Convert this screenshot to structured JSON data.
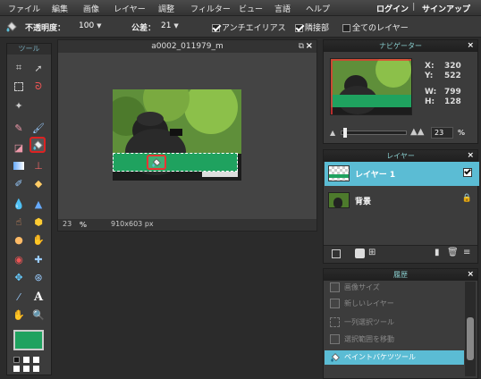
{
  "menubar": {
    "items": [
      "ファイル",
      "編集",
      "画像",
      "レイヤー",
      "調整",
      "フィルター",
      "ビュー",
      "言語",
      "ヘルプ"
    ],
    "login": "ログイン",
    "separator": "|",
    "signup": "サインアップ"
  },
  "options": {
    "opacity_label": "不透明度：",
    "opacity_value": "100",
    "tolerance_label": "公差：",
    "tolerance_value": "21",
    "antialias_label": "アンチエイリアス",
    "contiguous_label": "隣接部",
    "all_layers_label": "全てのレイヤー"
  },
  "toolbox": {
    "title": "ツール"
  },
  "document": {
    "title": "a0002_011979_m",
    "zoom": "23",
    "zoom_unit": "%",
    "size": "910x603 px"
  },
  "navigator": {
    "title": "ナビゲーター",
    "x_label": "X:",
    "x_value": "320",
    "y_label": "Y:",
    "y_value": "522",
    "w_label": "W:",
    "w_value": "799",
    "h_label": "H:",
    "h_value": "128",
    "zoom_value": "23",
    "zoom_unit": "%",
    "zoom_slider_level": 0.05
  },
  "layers": {
    "title": "レイヤー",
    "items": [
      {
        "name": "レイヤー 1"
      },
      {
        "name": "背景"
      }
    ]
  },
  "history": {
    "title": "履歴",
    "items": [
      {
        "label": "画像サイズ"
      },
      {
        "label": "新しいレイヤー"
      },
      {
        "label": "一列選択ツール"
      },
      {
        "label": "選択範囲を移動"
      },
      {
        "label": "ペイントバケツツール"
      }
    ]
  },
  "colors": {
    "accent": "#5bbcd4",
    "fill_green": "#1fa25f",
    "selection_red": "#e33333"
  }
}
